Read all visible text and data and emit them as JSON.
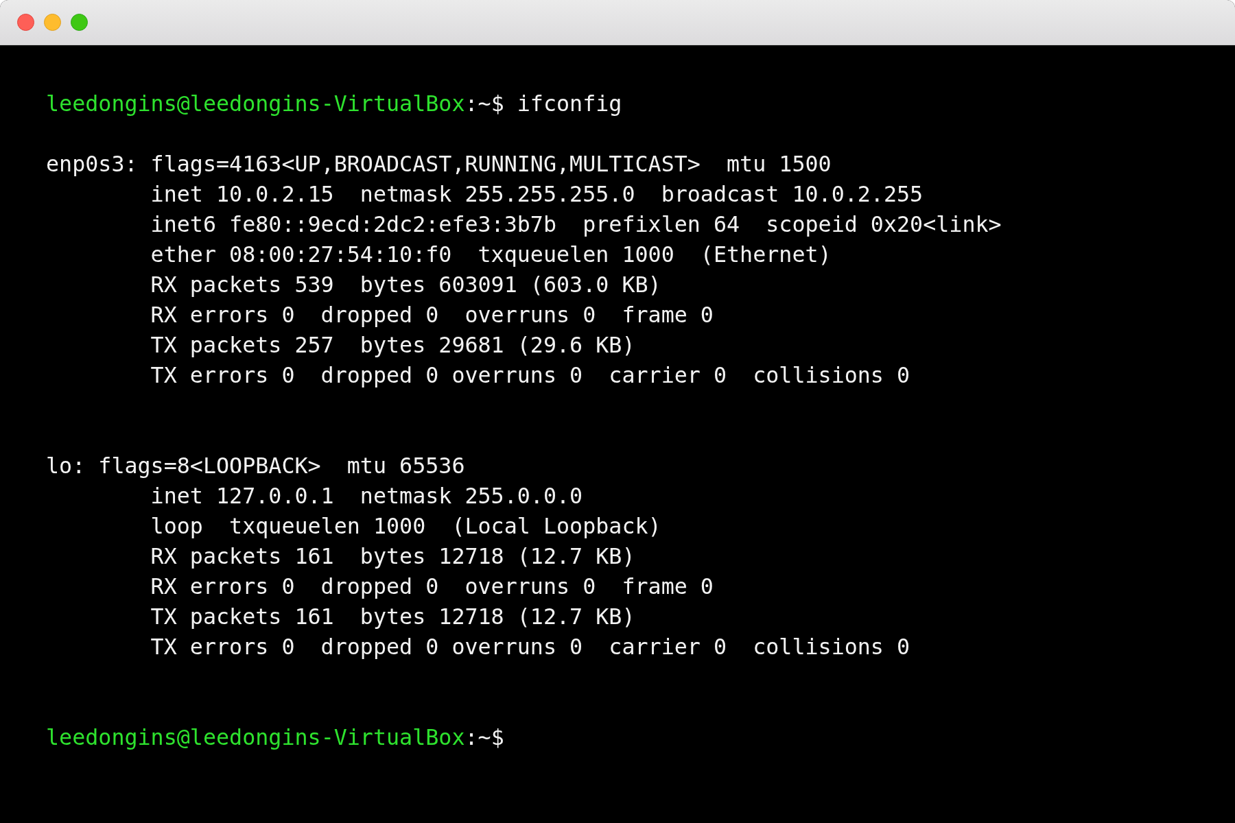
{
  "terminal": {
    "blocks": [
      {
        "kind": "prompt",
        "user_host": "leedongins@leedongins-VirtualBox",
        "path": ":~$",
        "command": "ifconfig"
      },
      {
        "kind": "interface",
        "header": "enp0s3: flags=4163<UP,BROADCAST,RUNNING,MULTICAST>  mtu 1500",
        "details": [
          "inet 10.0.2.15  netmask 255.255.255.0  broadcast 10.0.2.255",
          "inet6 fe80::9ecd:2dc2:efe3:3b7b  prefixlen 64  scopeid 0x20<link>",
          "ether 08:00:27:54:10:f0  txqueuelen 1000  (Ethernet)",
          "RX packets 539  bytes 603091 (603.0 KB)",
          "RX errors 0  dropped 0  overruns 0  frame 0",
          "TX packets 257  bytes 29681 (29.6 KB)",
          "TX errors 0  dropped 0 overruns 0  carrier 0  collisions 0"
        ]
      },
      {
        "kind": "interface",
        "header": "lo: flags=8<LOOPBACK>  mtu 65536",
        "details": [
          "inet 127.0.0.1  netmask 255.0.0.0",
          "loop  txqueuelen 1000  (Local Loopback)",
          "RX packets 161  bytes 12718 (12.7 KB)",
          "RX errors 0  dropped 0  overruns 0  frame 0",
          "TX packets 161  bytes 12718 (12.7 KB)",
          "TX errors 0  dropped 0 overruns 0  carrier 0  collisions 0"
        ]
      },
      {
        "kind": "prompt",
        "user_host": "leedongins@leedongins-VirtualBox",
        "path": ":~$"
      }
    ]
  }
}
